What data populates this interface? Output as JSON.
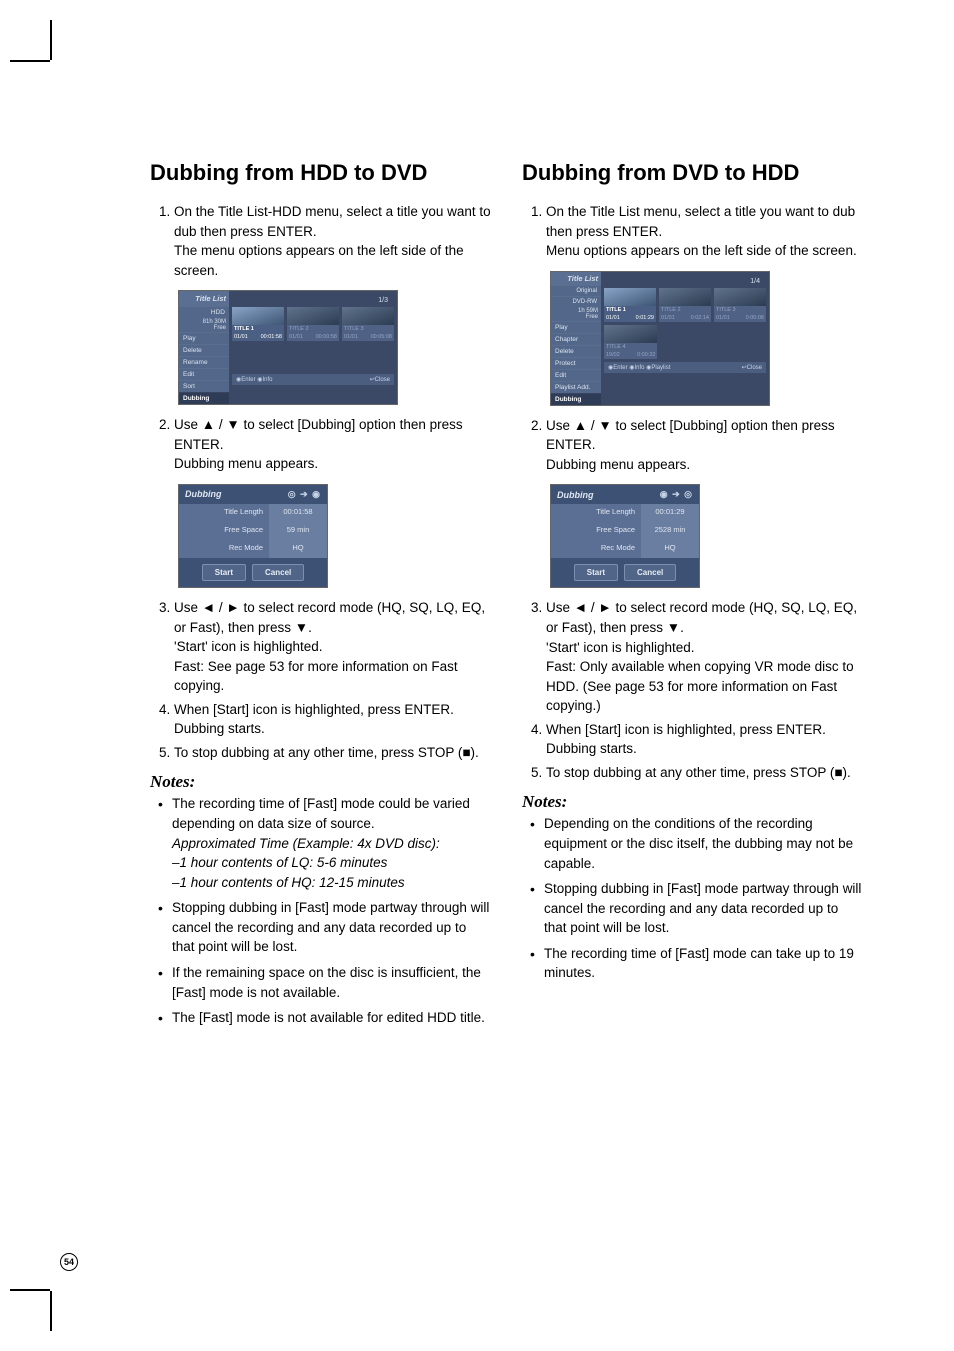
{
  "page_number": "54",
  "left": {
    "heading": "Dubbing from HDD to DVD",
    "steps": [
      {
        "pre": "On the Title List-HDD menu, select a title you want to dub then press ENTER.",
        "sub": "The menu options appears on the left side of the screen."
      },
      {
        "pre": "Use ▲ / ▼ to select [Dubbing] option then press ENTER.",
        "sub": "Dubbing menu appears."
      },
      {
        "pre": "Use ◄ / ► to select record mode (HQ, SQ, LQ, EQ, or Fast), then press ▼.",
        "sub": "'Start' icon is highlighted.",
        "sub2": "Fast: See page 53 for more information on Fast copying."
      },
      {
        "pre": "When [Start] icon is highlighted, press ENTER.",
        "sub": "Dubbing starts."
      },
      {
        "pre": "To stop dubbing at any other time, press STOP (■)."
      }
    ],
    "notes_label": "Notes:",
    "notes": [
      {
        "text": "The recording time of [Fast] mode could be varied depending on data size of source.",
        "italic1": "Approximated Time (Example: 4x DVD disc):",
        "italic2": "–1 hour contents of LQ: 5-6 minutes",
        "italic3": "–1 hour contents of HQ: 12-15 minutes"
      },
      {
        "text": "Stopping dubbing in [Fast] mode partway through will cancel the recording and any data recorded up to that point will be lost."
      },
      {
        "text": "If the remaining space on the disc is insufficient, the [Fast] mode is not available."
      },
      {
        "text": "The [Fast] mode is not available for edited HDD title."
      }
    ],
    "fig_titlelist": {
      "title": "Title List",
      "right_tag": "1/3",
      "sidebar_top": "HDD",
      "sidebar_free_a": "81h 30M",
      "sidebar_free_b": "Free",
      "menu": [
        "Play",
        "Delete",
        "Rename",
        "Edit",
        "Sort",
        "Dubbing"
      ],
      "thumbs": [
        {
          "name": "TITLE 1",
          "date": "01/01",
          "dur": "00:01:58",
          "sel": true
        },
        {
          "name": "TITLE 2",
          "date": "01/01",
          "dur": "00:00:58"
        },
        {
          "name": "TITLE 3",
          "date": "01/01",
          "dur": "00:05:08"
        }
      ],
      "footer_left": "◉Enter   ◉Info",
      "footer_right": "↩Close"
    },
    "fig_dub": {
      "title": "Dubbing",
      "icons": "◎ ➔ ◉",
      "rows": [
        {
          "label": "Title Length",
          "value": "00:01:58"
        },
        {
          "label": "Free Space",
          "value": "59 min"
        },
        {
          "label": "Rec Mode",
          "value": "HQ"
        }
      ],
      "btn_start": "Start",
      "btn_cancel": "Cancel"
    }
  },
  "right": {
    "heading": "Dubbing from DVD to HDD",
    "steps": [
      {
        "pre": "On the Title List menu, select a title you want to dub then press ENTER.",
        "sub": "Menu options appears on the left side of the screen."
      },
      {
        "pre": "Use ▲ / ▼ to select [Dubbing] option then press ENTER.",
        "sub": "Dubbing menu appears."
      },
      {
        "pre": "Use ◄ / ► to select record mode  (HQ, SQ, LQ, EQ, or Fast), then press ▼.",
        "sub": "'Start' icon is highlighted.",
        "sub2": "Fast: Only available when copying VR mode disc to HDD. (See page 53 for more information on Fast copying.)"
      },
      {
        "pre": "When [Start] icon is highlighted, press ENTER.",
        "sub": "Dubbing starts."
      },
      {
        "pre": "To stop dubbing at any other time, press STOP (■)."
      }
    ],
    "notes_label": "Notes:",
    "notes": [
      {
        "text": "Depending on the conditions of the recording equipment or the disc itself, the dubbing may not be capable."
      },
      {
        "text": "Stopping dubbing in [Fast] mode partway through will cancel the recording and any data recorded up to that point will be lost."
      },
      {
        "text": "The recording time of [Fast] mode can take up to 19 minutes."
      }
    ],
    "fig_titlelist": {
      "title": "Title List",
      "sub1": "Original",
      "sub2": "DVD-RW",
      "right_tag": "1/4",
      "sidebar_free_a": "1h 59M",
      "sidebar_free_b": "Free",
      "menu": [
        "Play",
        "Chapter",
        "Delete",
        "Protect",
        "Edit",
        "Playlist Add.",
        "Dubbing"
      ],
      "thumbs_row1": [
        {
          "name": "TITLE 1",
          "date": "01/01",
          "dur": "0:01:29",
          "sel": true
        },
        {
          "name": "TITLE 2",
          "date": "01/01",
          "dur": "0:02:14"
        },
        {
          "name": "TITLE 3",
          "date": "01/01",
          "dur": "0:00:08"
        }
      ],
      "thumbs_row2": [
        {
          "name": "TITLE 4",
          "date": "19/02",
          "dur": "0:00:32"
        }
      ],
      "footer_left": "◉Enter ◉Info ◉Playlist",
      "footer_right": "↩Close"
    },
    "fig_dub": {
      "title": "Dubbing",
      "icons": "◉ ➔ ◎",
      "rows": [
        {
          "label": "Title Length",
          "value": "00:01:29"
        },
        {
          "label": "Free Space",
          "value": "2528 min"
        },
        {
          "label": "Rec Mode",
          "value": "HQ"
        }
      ],
      "btn_start": "Start",
      "btn_cancel": "Cancel"
    }
  }
}
